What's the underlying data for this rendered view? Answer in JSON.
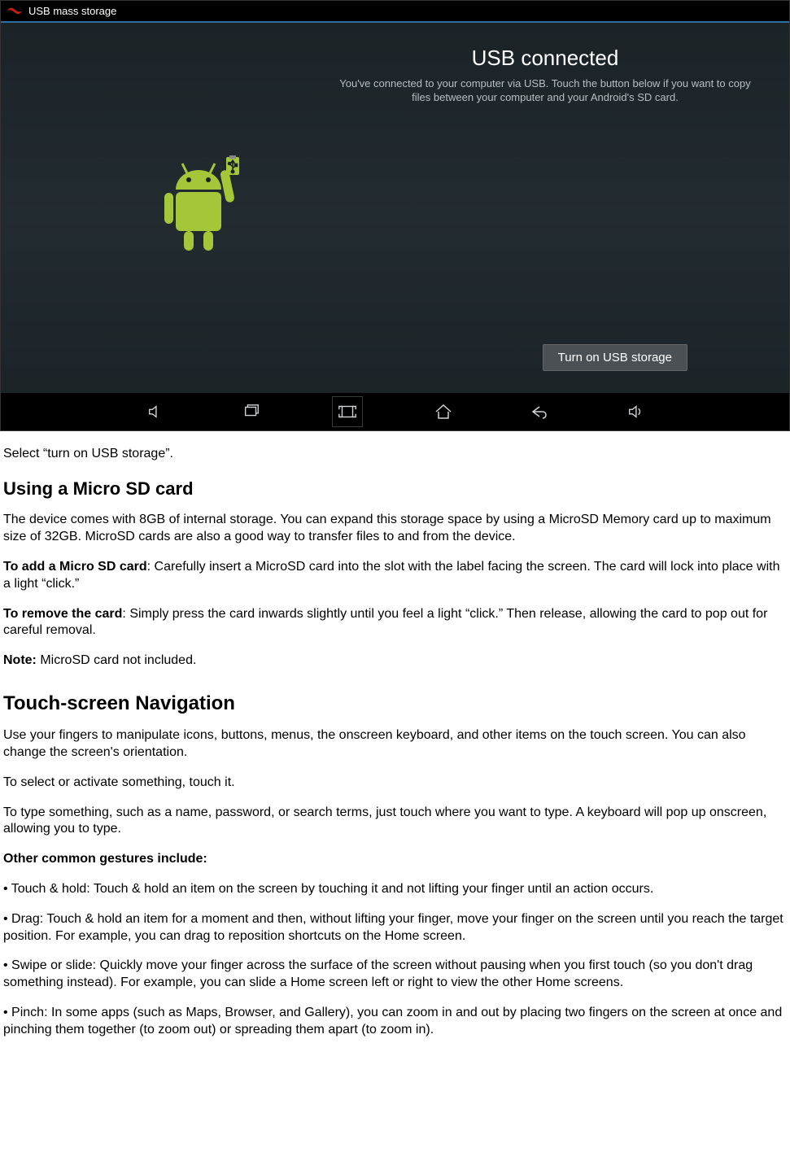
{
  "screenshot": {
    "titlebar": "USB mass storage",
    "heading": "USB connected",
    "subtext": "You've connected to your computer via USB. Touch the button below if you want to copy files between your computer and your Android's SD card.",
    "button": "Turn on USB storage",
    "nav": {
      "vol_down": "volume-down",
      "recent": "recent-apps",
      "screenshot": "screenshot",
      "home": "home",
      "back": "back",
      "vol_up": "volume-up"
    }
  },
  "doc": {
    "p1": "Select “turn on USB storage”.",
    "h1": "Using a Micro SD card",
    "p2": "The device comes with 8GB of internal storage. You can expand this storage space by using a MicroSD Memory card up to maximum size of 32GB. MicroSD cards are also a good way to transfer files to and from the device.",
    "p3_b": "To add a Micro SD card",
    "p3_r": ": Carefully insert a MicroSD card into the slot with the label facing the screen. The card will lock into place with a light “click.”",
    "p4_b": "To remove the card",
    "p4_r": ": Simply press the card inwards slightly until you feel a light “click.” Then release, allowing the card to pop out for careful removal.",
    "p5_b": "Note:",
    "p5_r": " MicroSD card not included.",
    "h2": "Touch-screen Navigation",
    "p6": "Use your fingers to manipulate icons, buttons, menus, the onscreen keyboard, and other items on the touch screen. You can also change the screen's orientation.",
    "p7": "To select or activate something, touch it.",
    "p8": "To type something, such as a name, password, or search terms, just touch where you want to type. A keyboard will pop up onscreen, allowing you to type.",
    "p9": "Other common gestures include:",
    "p10": "• Touch & hold: Touch & hold an item on the screen by touching it and not lifting your finger until an action occurs.",
    "p11": "• Drag: Touch & hold an item for a moment and then, without lifting your finger, move your finger on the screen until you reach the target position. For example, you can drag to reposition shortcuts on the Home screen.",
    "p12": "• Swipe or slide: Quickly move your finger across the surface of the screen without pausing when you first touch (so you don't drag something instead). For example, you can slide a Home screen left or right to view the other Home screens.",
    "p13": "• Pinch: In some apps (such as Maps, Browser, and Gallery), you can zoom in and out by placing two fingers on the screen at once and pinching them together (to zoom out) or spreading them apart (to zoom in)."
  }
}
